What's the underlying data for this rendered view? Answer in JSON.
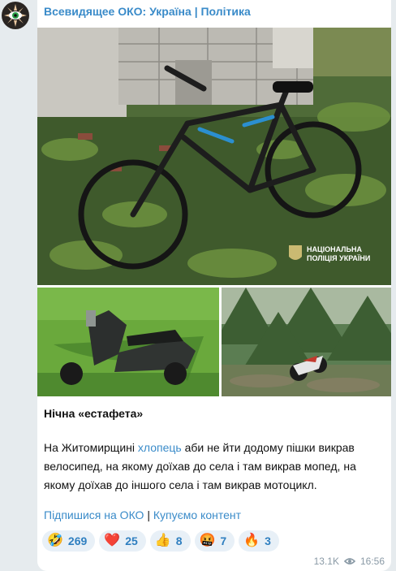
{
  "channel": {
    "title": "Всевидящее ОКО: Україна | Політика"
  },
  "photos": {
    "main_watermark_line1": "НАЦІОНАЛЬНА",
    "main_watermark_line2": "ПОЛІЦІЯ УКРАЇНИ"
  },
  "post": {
    "heading": "Нічна «естафета»",
    "text_before_link": "На Житомирщині ",
    "link_word": "хлопець",
    "text_after_link": " аби не йти додому пішки викрав велосипед, на якому доїхав до села і там викрав мопед, на якому доїхав до іншого села і там викрав мотоцикл.",
    "subscribe_link": "Підпишися на ОКО",
    "separator": " | ",
    "buy_link": "Купуємо контент"
  },
  "reactions": [
    {
      "emoji": "🤣",
      "icon": "rofl-icon",
      "count": "269"
    },
    {
      "emoji": "❤️",
      "icon": "heart-icon",
      "count": "25"
    },
    {
      "emoji": "👍",
      "icon": "thumbs-up-icon",
      "count": "8"
    },
    {
      "emoji": "🤬",
      "icon": "angry-face-icon",
      "count": "7"
    },
    {
      "emoji": "🔥",
      "icon": "fire-icon",
      "count": "3"
    }
  ],
  "meta": {
    "views": "13.1K",
    "time": "16:56"
  },
  "colors": {
    "link": "#3a8bc9",
    "reaction_bg": "#e8f0f7",
    "background": "#e6ebee"
  }
}
